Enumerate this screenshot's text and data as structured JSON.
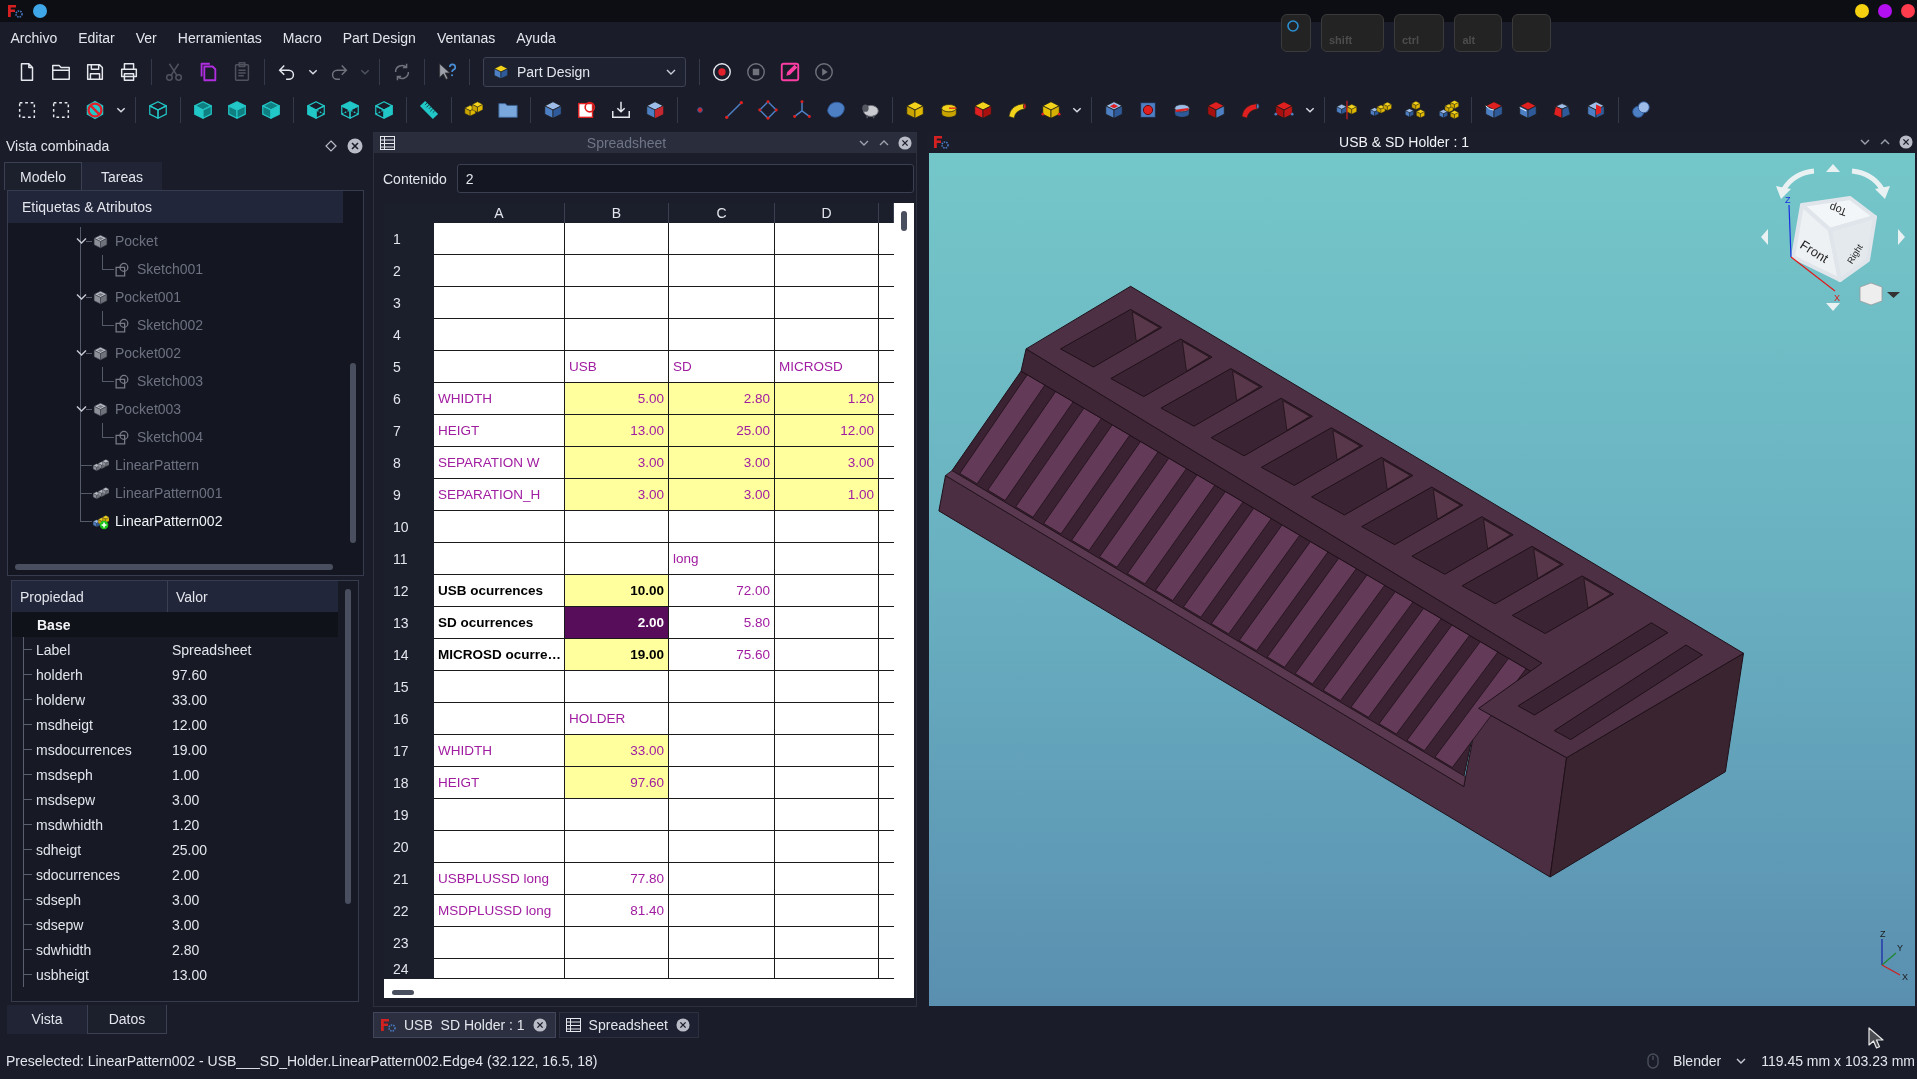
{
  "title_bar": {
    "keys": [
      {
        "kind": "ring"
      },
      {
        "kind": "key",
        "label": "shift"
      },
      {
        "kind": "key",
        "label": "ctrl"
      },
      {
        "kind": "key",
        "label": "alt"
      },
      {
        "kind": "blank"
      }
    ]
  },
  "menu": [
    "Archivo",
    "Editar",
    "Ver",
    "Herramientas",
    "Macro",
    "Part Design",
    "Ventanas",
    "Ayuda"
  ],
  "toolbar_top": [
    [
      {
        "kind": "new",
        "disabled": false
      },
      {
        "kind": "open",
        "disabled": false
      },
      {
        "kind": "save",
        "disabled": false
      },
      {
        "kind": "print",
        "disabled": false
      }
    ],
    [
      {
        "kind": "cut",
        "disabled": true
      },
      {
        "kind": "copy",
        "disabled": false
      },
      {
        "kind": "paste",
        "disabled": true
      }
    ],
    [
      {
        "kind": "undo",
        "disabled": false
      },
      {
        "kind": "menu",
        "disabled": false
      },
      {
        "kind": "redo",
        "disabled": true
      },
      {
        "kind": "menu",
        "disabled": true
      }
    ],
    [
      {
        "kind": "refresh",
        "disabled": true
      }
    ],
    [
      {
        "kind": "whats_this",
        "disabled": false
      }
    ],
    [
      {
        "kind": "workbench",
        "label": "Part Design",
        "disabled": false
      }
    ],
    [
      {
        "kind": "record",
        "disabled": false
      },
      {
        "kind": "stop",
        "disabled": true
      },
      {
        "kind": "macro_edit",
        "disabled": false
      },
      {
        "kind": "play",
        "disabled": true
      }
    ]
  ],
  "toolbar_bottom": [
    [
      {
        "kind": "box_select"
      },
      {
        "kind": "box_select"
      },
      {
        "kind": "no_draw"
      },
      {
        "kind": "menu"
      }
    ],
    [
      {
        "kind": "view_iso"
      }
    ],
    [
      {
        "kind": "view_front"
      },
      {
        "kind": "view_top"
      },
      {
        "kind": "view_right"
      }
    ],
    [
      {
        "kind": "view_rear"
      },
      {
        "kind": "view_bottom"
      },
      {
        "kind": "view_left"
      }
    ],
    [
      {
        "kind": "measure"
      }
    ],
    [
      {
        "kind": "part"
      },
      {
        "kind": "group"
      }
    ],
    [
      {
        "kind": "body"
      },
      {
        "kind": "sketch"
      },
      {
        "kind": "import"
      },
      {
        "kind": "binder"
      }
    ],
    [
      {
        "kind": "point"
      },
      {
        "kind": "line"
      },
      {
        "kind": "plane"
      },
      {
        "kind": "lcs"
      },
      {
        "kind": "shape_binder"
      },
      {
        "kind": "clone"
      }
    ],
    [
      {
        "kind": "pad"
      },
      {
        "kind": "revolution"
      },
      {
        "kind": "loft"
      },
      {
        "kind": "pipe"
      },
      {
        "kind": "primitive"
      },
      {
        "kind": "menu"
      }
    ],
    [
      {
        "kind": "pocket"
      },
      {
        "kind": "hole"
      },
      {
        "kind": "groove"
      },
      {
        "kind": "sub_loft"
      },
      {
        "kind": "sub_pipe"
      },
      {
        "kind": "sub_primitive"
      },
      {
        "kind": "menu"
      }
    ],
    [
      {
        "kind": "mirrored"
      },
      {
        "kind": "linear"
      },
      {
        "kind": "polar"
      },
      {
        "kind": "multi"
      }
    ],
    [
      {
        "kind": "fillet"
      },
      {
        "kind": "chamfer"
      },
      {
        "kind": "draft"
      },
      {
        "kind": "thickness"
      }
    ],
    [
      {
        "kind": "boolean"
      }
    ]
  ],
  "combo_view": {
    "title": "Vista combinada",
    "tabs": [
      {
        "label": "Modelo",
        "selected": true
      },
      {
        "label": "Tareas",
        "selected": false
      }
    ],
    "tree": {
      "header": "Etiquetas & Atributos",
      "items": [
        {
          "label": "Pocket",
          "kind": "pocket",
          "visible": false,
          "tip": false,
          "expanded": true,
          "children": [
            {
              "label": "Sketch001",
              "kind": "sketch",
              "visible": false
            }
          ]
        },
        {
          "label": "Pocket001",
          "kind": "pocket",
          "visible": false,
          "tip": false,
          "expanded": true,
          "children": [
            {
              "label": "Sketch002",
              "kind": "sketch",
              "visible": false
            }
          ]
        },
        {
          "label": "Pocket002",
          "kind": "pocket",
          "visible": false,
          "tip": false,
          "expanded": true,
          "children": [
            {
              "label": "Sketch003",
              "kind": "sketch",
              "visible": false
            }
          ]
        },
        {
          "label": "Pocket003",
          "kind": "pocket",
          "visible": false,
          "tip": false,
          "expanded": true,
          "children": [
            {
              "label": "Sketch004",
              "kind": "sketch",
              "visible": false
            }
          ]
        },
        {
          "label": "LinearPattern",
          "kind": "pattern",
          "visible": false,
          "tip": false
        },
        {
          "label": "LinearPattern001",
          "kind": "pattern",
          "visible": false,
          "tip": false
        },
        {
          "label": "LinearPattern002",
          "kind": "pattern",
          "visible": true,
          "tip": true
        }
      ]
    },
    "properties": {
      "columns": [
        "Propiedad",
        "Valor"
      ],
      "group": "Base",
      "rows": [
        {
          "name": "Label",
          "value": "Spreadsheet"
        },
        {
          "name": "holderh",
          "value": "97.60"
        },
        {
          "name": "holderw",
          "value": "33.00"
        },
        {
          "name": "msdheigt",
          "value": "12.00"
        },
        {
          "name": "msdocurrences",
          "value": "19.00"
        },
        {
          "name": "msdseph",
          "value": "1.00"
        },
        {
          "name": "msdsepw",
          "value": "3.00"
        },
        {
          "name": "msdwhidth",
          "value": "1.20"
        },
        {
          "name": "sdheigt",
          "value": "25.00"
        },
        {
          "name": "sdocurrences",
          "value": "2.00"
        },
        {
          "name": "sdseph",
          "value": "3.00"
        },
        {
          "name": "sdsepw",
          "value": "3.00"
        },
        {
          "name": "sdwhidth",
          "value": "2.80"
        },
        {
          "name": "usbheigt",
          "value": "13.00"
        }
      ]
    },
    "bottom_tabs": [
      {
        "label": "Vista",
        "selected": false
      },
      {
        "label": "Datos",
        "selected": true
      }
    ]
  },
  "spreadsheet": {
    "title": "Spreadsheet",
    "active": false,
    "content_label": "Contenido",
    "content_value": "2",
    "columns": [
      "A",
      "B",
      "C",
      "D"
    ],
    "rows": [
      {
        "header": "1",
        "cells": [
          {
            "selected": false,
            "highlighted": false
          },
          {
            "selected": false,
            "highlighted": false
          },
          {
            "selected": false,
            "highlighted": false
          },
          {
            "selected": false,
            "highlighted": false
          }
        ]
      },
      {
        "header": "2",
        "cells": [
          {
            "selected": false,
            "highlighted": false
          },
          {
            "selected": false,
            "highlighted": false
          },
          {
            "selected": false,
            "highlighted": false
          },
          {
            "selected": false,
            "highlighted": false
          }
        ]
      },
      {
        "header": "3",
        "cells": [
          {
            "selected": false,
            "highlighted": false
          },
          {
            "selected": false,
            "highlighted": false
          },
          {
            "selected": false,
            "highlighted": false
          },
          {
            "selected": false,
            "highlighted": false
          }
        ]
      },
      {
        "header": "4",
        "cells": [
          {
            "selected": false,
            "highlighted": false
          },
          {
            "selected": false,
            "highlighted": false
          },
          {
            "selected": false,
            "highlighted": false
          },
          {
            "selected": false,
            "highlighted": false
          }
        ]
      },
      {
        "header": "5",
        "cells": [
          {
            "selected": false,
            "highlighted": false
          },
          {
            "text": "USB",
            "kind": "text",
            "color": "#a01ca0",
            "bold": false,
            "selected": false,
            "highlighted": false
          },
          {
            "text": "SD",
            "kind": "text",
            "color": "#a01ca0",
            "bold": false,
            "selected": false,
            "highlighted": false
          },
          {
            "text": "MICROSD",
            "kind": "text",
            "color": "#a01ca0",
            "bold": false,
            "selected": false,
            "highlighted": false
          }
        ]
      },
      {
        "header": "6",
        "cells": [
          {
            "text": "WHIDTH",
            "kind": "text",
            "color": "#a01ca0",
            "bold": false,
            "selected": false,
            "highlighted": false
          },
          {
            "text": "5.00",
            "kind": "number",
            "color": "#a01ca0",
            "bold": false,
            "selected": false,
            "highlighted": true
          },
          {
            "text": "2.80",
            "kind": "number",
            "color": "#a01ca0",
            "bold": false,
            "selected": false,
            "highlighted": true
          },
          {
            "text": "1.20",
            "kind": "number",
            "color": "#a01ca0",
            "bold": false,
            "selected": false,
            "highlighted": true
          }
        ]
      },
      {
        "header": "7",
        "cells": [
          {
            "text": "HEIGT",
            "kind": "text",
            "color": "#a01ca0",
            "bold": false,
            "selected": false,
            "highlighted": false
          },
          {
            "text": "13.00",
            "kind": "number",
            "color": "#a01ca0",
            "bold": false,
            "selected": false,
            "highlighted": true
          },
          {
            "text": "25.00",
            "kind": "number",
            "color": "#a01ca0",
            "bold": false,
            "selected": false,
            "highlighted": true
          },
          {
            "text": "12.00",
            "kind": "number",
            "color": "#a01ca0",
            "bold": false,
            "selected": false,
            "highlighted": true
          }
        ]
      },
      {
        "header": "8",
        "cells": [
          {
            "text": "SEPARATION W",
            "kind": "text",
            "color": "#a01ca0",
            "bold": false,
            "selected": false,
            "highlighted": false
          },
          {
            "text": "3.00",
            "kind": "number",
            "color": "#a01ca0",
            "bold": false,
            "selected": false,
            "highlighted": true
          },
          {
            "text": "3.00",
            "kind": "number",
            "color": "#a01ca0",
            "bold": false,
            "selected": false,
            "highlighted": true
          },
          {
            "text": "3.00",
            "kind": "number",
            "color": "#a01ca0",
            "bold": false,
            "selected": false,
            "highlighted": true
          }
        ]
      },
      {
        "header": "9",
        "cells": [
          {
            "text": "SEPARATION_H",
            "kind": "text",
            "color": "#a01ca0",
            "bold": false,
            "selected": false,
            "highlighted": false
          },
          {
            "text": "3.00",
            "kind": "number",
            "color": "#a01ca0",
            "bold": false,
            "selected": false,
            "highlighted": true
          },
          {
            "text": "3.00",
            "kind": "number",
            "color": "#a01ca0",
            "bold": false,
            "selected": false,
            "highlighted": true
          },
          {
            "text": "1.00",
            "kind": "number",
            "bold": false,
            "selected": false,
            "highlighted": true
          }
        ]
      },
      {
        "header": "10",
        "cells": [
          {
            "selected": false,
            "highlighted": false
          },
          {
            "selected": false,
            "highlighted": false
          },
          {
            "selected": false,
            "highlighted": false
          },
          {
            "selected": false,
            "highlighted": false
          }
        ]
      },
      {
        "header": "11",
        "cells": [
          {
            "selected": false,
            "highlighted": false
          },
          {
            "selected": false,
            "highlighted": false
          },
          {
            "text": "long",
            "kind": "text",
            "color": "#a01ca0",
            "bold": false,
            "selected": false,
            "highlighted": false
          },
          {
            "selected": false,
            "highlighted": false
          }
        ]
      },
      {
        "header": "12",
        "cells": [
          {
            "text": "USB ocurrences",
            "kind": "text",
            "color": "#000000",
            "bold": true,
            "selected": false,
            "highlighted": false
          },
          {
            "text": "10.00",
            "kind": "number",
            "bold": true,
            "selected": false,
            "highlighted": true
          },
          {
            "text": "72.00",
            "kind": "number",
            "color": "#a01ca0",
            "bold": false,
            "selected": false,
            "highlighted": false
          },
          {
            "selected": false,
            "highlighted": false
          }
        ]
      },
      {
        "header": "13",
        "cells": [
          {
            "text": "SD ocurrences",
            "kind": "text",
            "color": "#000000",
            "bold": true,
            "selected": false,
            "highlighted": false
          },
          {
            "text": "2.00",
            "kind": "number",
            "bold": true,
            "selected": true
          },
          {
            "text": "5.80",
            "kind": "number",
            "color": "#a01ca0",
            "bold": false,
            "selected": false,
            "highlighted": false
          },
          {
            "selected": false,
            "highlighted": false
          }
        ]
      },
      {
        "header": "14",
        "cells": [
          {
            "text": "MICROSD ocurre…",
            "kind": "text",
            "color": "#000000",
            "bold": true,
            "selected": false,
            "highlighted": false
          },
          {
            "text": "19.00",
            "kind": "number",
            "bold": true,
            "selected": false,
            "highlighted": true
          },
          {
            "text": "75.60",
            "kind": "number",
            "color": "#a01ca0",
            "bold": false,
            "selected": false,
            "highlighted": false
          },
          {
            "selected": false,
            "highlighted": false
          }
        ]
      },
      {
        "header": "15",
        "cells": [
          {
            "selected": false,
            "highlighted": false
          },
          {
            "selected": false,
            "highlighted": false
          },
          {
            "selected": false,
            "highlighted": false
          },
          {
            "selected": false,
            "highlighted": false
          }
        ]
      },
      {
        "header": "16",
        "cells": [
          {
            "selected": false,
            "highlighted": false
          },
          {
            "text": "HOLDER",
            "kind": "text",
            "color": "#a01ca0",
            "bold": false,
            "selected": false,
            "highlighted": false
          },
          {
            "selected": false,
            "highlighted": false
          },
          {
            "selected": false,
            "highlighted": false
          }
        ]
      },
      {
        "header": "17",
        "cells": [
          {
            "text": "WHIDTH",
            "kind": "text",
            "color": "#a01ca0",
            "bold": false,
            "selected": false,
            "highlighted": false
          },
          {
            "text": "33.00",
            "kind": "number",
            "bold": false,
            "selected": false,
            "highlighted": true
          },
          {
            "selected": false,
            "highlighted": false
          },
          {
            "selected": false,
            "highlighted": false
          }
        ]
      },
      {
        "header": "18",
        "cells": [
          {
            "text": "HEIGT",
            "kind": "text",
            "color": "#a01ca0",
            "bold": false,
            "selected": false,
            "highlighted": false
          },
          {
            "text": "97.60",
            "kind": "number",
            "bold": false,
            "selected": false,
            "highlighted": true
          },
          {
            "selected": false,
            "highlighted": false
          },
          {
            "selected": false,
            "highlighted": false
          }
        ]
      },
      {
        "header": "19",
        "cells": [
          {
            "selected": false,
            "highlighted": false
          },
          {
            "selected": false,
            "highlighted": false
          },
          {
            "selected": false,
            "highlighted": false
          },
          {
            "selected": false,
            "highlighted": false
          }
        ]
      },
      {
        "header": "20",
        "cells": [
          {
            "selected": false,
            "highlighted": false
          },
          {
            "selected": false,
            "highlighted": false
          },
          {
            "selected": false,
            "highlighted": false
          },
          {
            "selected": false,
            "highlighted": false
          }
        ]
      },
      {
        "header": "21",
        "cells": [
          {
            "text": "USBPLUSSD long",
            "kind": "text",
            "color": "#a01ca0",
            "bold": false,
            "selected": false,
            "highlighted": false
          },
          {
            "text": "77.80",
            "kind": "number",
            "color": "#a01ca0",
            "bold": false,
            "selected": false,
            "highlighted": false
          },
          {
            "selected": false,
            "highlighted": false
          },
          {
            "selected": false,
            "highlighted": false
          }
        ]
      },
      {
        "header": "22",
        "cells": [
          {
            "text": "MSDPLUSSD long",
            "kind": "text",
            "color": "#a01ca0",
            "bold": false,
            "selected": false,
            "highlighted": false
          },
          {
            "text": "81.40",
            "kind": "number",
            "color": "#a01ca0",
            "bold": false,
            "selected": false,
            "highlighted": false
          },
          {
            "selected": false,
            "highlighted": false
          },
          {
            "selected": false,
            "highlighted": false
          }
        ]
      },
      {
        "header": "23",
        "cells": [
          {
            "selected": false,
            "highlighted": false
          },
          {
            "selected": false,
            "highlighted": false
          },
          {
            "selected": false,
            "highlighted": false
          },
          {
            "selected": false,
            "highlighted": false
          }
        ]
      },
      {
        "header": "24",
        "cells": [
          {
            "selected": false,
            "highlighted": false
          },
          {
            "selected": false,
            "highlighted": false
          },
          {
            "selected": false,
            "highlighted": false
          },
          {
            "selected": false,
            "highlighted": false
          }
        ]
      }
    ]
  },
  "view_3d": {
    "title": "USB & SD Holder : 1",
    "active": true,
    "cube_faces": [
      "Top",
      "Front",
      "Right"
    ],
    "cube_axes": [
      "Z",
      "X"
    ],
    "axes": [
      "Z",
      "Y",
      "X"
    ]
  },
  "document_tabs": [
    {
      "label": "USB  SD Holder : 1",
      "kind": "model",
      "selected": true
    },
    {
      "label": "Spreadsheet",
      "kind": "sheet",
      "selected": false
    }
  ],
  "status_bar": {
    "message": "Preselected: LinearPattern002 - USB___SD_Holder.LinearPattern002.Edge4 (32.122, 16.5, 18)",
    "navigation": "Blender",
    "dimensions": "119.45 mm x 103.23 mm"
  }
}
